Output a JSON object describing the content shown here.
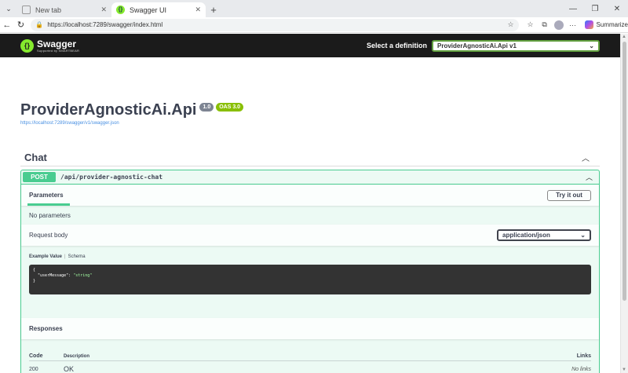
{
  "browser": {
    "tabs": [
      {
        "title": "New tab",
        "active": false
      },
      {
        "title": "Swagger UI",
        "active": true
      }
    ],
    "address": "https://localhost:7289/swagger/index.html",
    "summarize_label": "Summarize"
  },
  "topbar": {
    "logo_text": "Swagger",
    "logo_sub": "Supported by SMARTBEAR",
    "select_label": "Select a definition",
    "selected_definition": "ProviderAgnosticAi.Api v1"
  },
  "info": {
    "title": "ProviderAgnosticAi.Api",
    "version": "1.0",
    "oas": "OAS 3.0",
    "spec_url": "https://localhost:7289/swagger/v1/swagger.json"
  },
  "tag": {
    "name": "Chat"
  },
  "operation": {
    "method": "POST",
    "path": "/api/provider-agnostic-chat",
    "parameters_tab": "Parameters",
    "try_label": "Try it out",
    "no_params": "No parameters",
    "request_body_label": "Request body",
    "content_type": "application/json",
    "example_tab": "Example Value",
    "schema_tab": "Schema",
    "example_line1": "{",
    "example_key": "\"userMessage\"",
    "example_colon": ": ",
    "example_value": "\"string\"",
    "example_line3": "}"
  },
  "responses": {
    "title": "Responses",
    "columns": {
      "code": "Code",
      "description": "Description",
      "links": "Links"
    },
    "rows": [
      {
        "code": "200",
        "description": "OK",
        "links": "No links"
      }
    ]
  },
  "colors": {
    "post_green": "#49cc90",
    "swagger_green": "#85ea2d",
    "topbar": "#1b1b1b",
    "text": "#3b4151"
  }
}
